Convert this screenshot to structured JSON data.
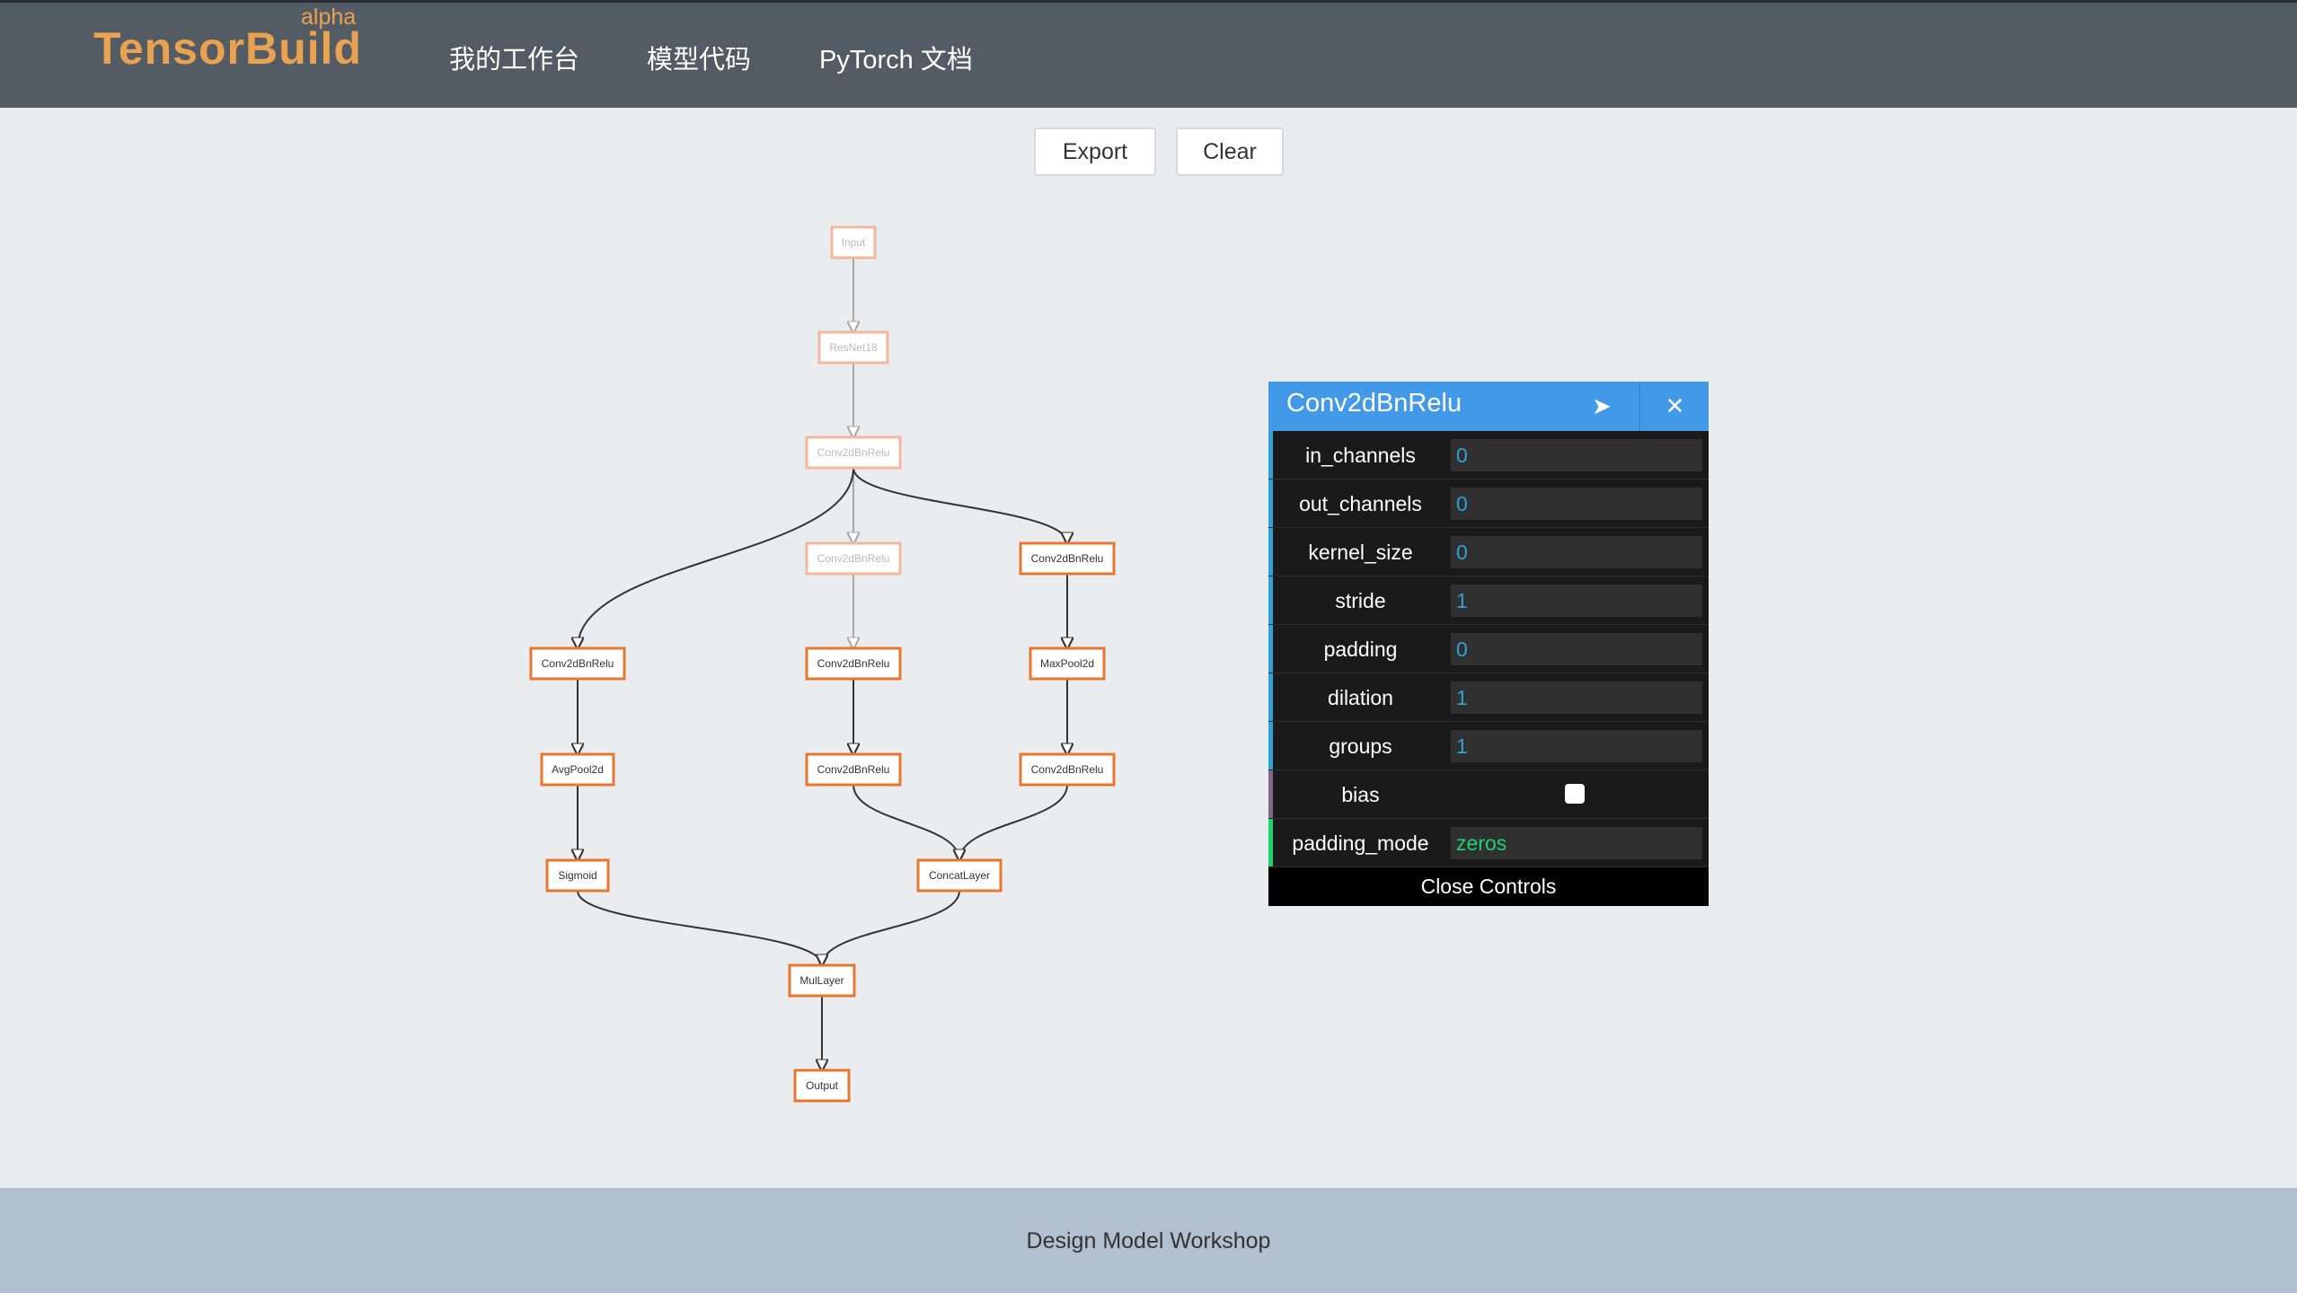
{
  "header": {
    "brand": "TensorBuild",
    "brand_tag": "alpha",
    "nav": [
      {
        "label": "我的工作台"
      },
      {
        "label": "模型代码"
      },
      {
        "label": "PyTorch 文档"
      }
    ]
  },
  "toolbar": {
    "export_label": "Export",
    "clear_label": "Clear"
  },
  "graph": {
    "colors": {
      "active": "#e8772e",
      "inactive": "#f4b79c",
      "edge_active": "#333333",
      "edge_inactive": "#a8a8a8"
    },
    "nodes": [
      {
        "id": "input",
        "label": "Input",
        "active": false
      },
      {
        "id": "resnet18",
        "label": "ResNet18",
        "active": false
      },
      {
        "id": "conv_root",
        "label": "Conv2dBnRelu",
        "active": false
      },
      {
        "id": "conv_mid1",
        "label": "Conv2dBnRelu",
        "active": false
      },
      {
        "id": "conv_right1",
        "label": "Conv2dBnRelu",
        "active": true
      },
      {
        "id": "conv_left1",
        "label": "Conv2dBnRelu",
        "active": true
      },
      {
        "id": "conv_mid2",
        "label": "Conv2dBnRelu",
        "active": true
      },
      {
        "id": "maxpool",
        "label": "MaxPool2d",
        "active": true
      },
      {
        "id": "avgpool",
        "label": "AvgPool2d",
        "active": true
      },
      {
        "id": "conv_mid3",
        "label": "Conv2dBnRelu",
        "active": true
      },
      {
        "id": "conv_right2",
        "label": "Conv2dBnRelu",
        "active": true
      },
      {
        "id": "sigmoid",
        "label": "Sigmoid",
        "active": true
      },
      {
        "id": "concat",
        "label": "ConcatLayer",
        "active": true
      },
      {
        "id": "mul",
        "label": "MulLayer",
        "active": true
      },
      {
        "id": "output",
        "label": "Output",
        "active": true
      }
    ],
    "edges": [
      {
        "from": "input",
        "to": "resnet18",
        "active": false
      },
      {
        "from": "resnet18",
        "to": "conv_root",
        "active": false
      },
      {
        "from": "conv_root",
        "to": "conv_mid1",
        "active": false
      },
      {
        "from": "conv_root",
        "to": "conv_left1",
        "active": true
      },
      {
        "from": "conv_root",
        "to": "conv_right1",
        "active": true
      },
      {
        "from": "conv_mid1",
        "to": "conv_mid2",
        "active": false
      },
      {
        "from": "conv_right1",
        "to": "maxpool",
        "active": true
      },
      {
        "from": "conv_left1",
        "to": "avgpool",
        "active": true
      },
      {
        "from": "conv_mid2",
        "to": "conv_mid3",
        "active": true
      },
      {
        "from": "maxpool",
        "to": "conv_right2",
        "active": true
      },
      {
        "from": "avgpool",
        "to": "sigmoid",
        "active": true
      },
      {
        "from": "conv_mid3",
        "to": "concat",
        "active": true
      },
      {
        "from": "conv_right2",
        "to": "concat",
        "active": true
      },
      {
        "from": "sigmoid",
        "to": "mul",
        "active": true
      },
      {
        "from": "concat",
        "to": "mul",
        "active": true
      },
      {
        "from": "mul",
        "to": "output",
        "active": true
      }
    ]
  },
  "panel": {
    "title": "Conv2dBnRelu",
    "send_icon": "send-icon",
    "close_icon": "close-icon",
    "params": [
      {
        "label": "in_channels",
        "value": "0",
        "type": "number"
      },
      {
        "label": "out_channels",
        "value": "0",
        "type": "number"
      },
      {
        "label": "kernel_size",
        "value": "0",
        "type": "number"
      },
      {
        "label": "stride",
        "value": "1",
        "type": "number"
      },
      {
        "label": "padding",
        "value": "0",
        "type": "number"
      },
      {
        "label": "dilation",
        "value": "1",
        "type": "number"
      },
      {
        "label": "groups",
        "value": "1",
        "type": "number"
      },
      {
        "label": "bias",
        "value": "",
        "type": "boolean"
      },
      {
        "label": "padding_mode",
        "value": "zeros",
        "type": "string"
      }
    ],
    "bar_colors": {
      "number": "#2fa1d6",
      "boolean": "#806787",
      "string": "#1ed36f"
    },
    "close_label": "Close Controls"
  },
  "footer": {
    "text": "Design Model Workshop"
  }
}
